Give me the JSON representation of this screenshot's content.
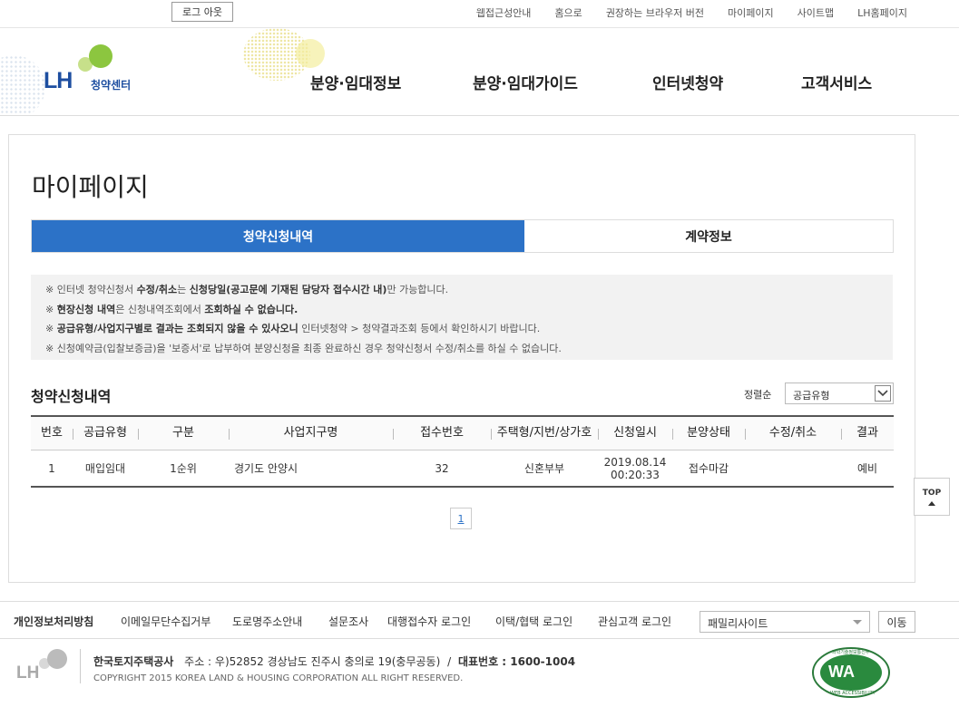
{
  "topbar": {
    "logout": "로그 아웃",
    "links": [
      "웹접근성안내",
      "홈으로",
      "권장하는 브라우저 버전",
      "마이페이지",
      "사이트맵",
      "LH홈페이지"
    ]
  },
  "header": {
    "logo_text": "LH",
    "logo_sub": "청약센터",
    "nav": [
      "분양·임대정보",
      "분양·임대가이드",
      "인터넷청약",
      "고객서비스"
    ]
  },
  "main": {
    "title": "마이페이지",
    "tabs": [
      {
        "label": "청약신청내역",
        "active": true
      },
      {
        "label": "계약정보",
        "active": false
      }
    ],
    "notice": [
      {
        "pre": "※ 인터넷 청약신청서 ",
        "bold": "수정/취소",
        "mid": "는 ",
        "bold2": "신청당일(공고문에 기재된 담당자 접수시간 내)",
        "post": "만 가능합니다."
      },
      {
        "pre": "※ ",
        "bold": "현장신청 내역",
        "mid": "은 신청내역조회에서 ",
        "bold2": "조회하실 수 없습니다.",
        "post": ""
      },
      {
        "pre": "※ ",
        "bold": "공급유형/사업지구별로 결과는 조회되지 않을 수 있사오니",
        "mid": " 인터넷청약 > 청약결과조회 등에서 확인하시기 바랍니다.",
        "bold2": "",
        "post": ""
      },
      {
        "pre": "※ 신청예약금(입찰보증금)을 '보증서'로 납부하여 분양신청을 최종 완료하신 경우 청약신청서 수정/취소를 하실 수 없습니다.",
        "bold": "",
        "mid": "",
        "bold2": "",
        "post": ""
      }
    ],
    "section_title": "청약신청내역",
    "sort_label": "정렬순",
    "sort_value": "공급유형",
    "table": {
      "headers": [
        "번호",
        "공급유형",
        "구분",
        "사업지구명",
        "접수번호",
        "주택형/지번/상가호",
        "신청일시",
        "분양상태",
        "수정/취소",
        "결과"
      ],
      "rows": [
        [
          "1",
          "매입임대",
          "1순위",
          "경기도 안양시",
          "32",
          "신혼부부",
          "2019.08.14\n00:20:33",
          "접수마감",
          "",
          "예비"
        ]
      ]
    },
    "pagination": [
      "1"
    ],
    "top_button": "TOP"
  },
  "footer": {
    "links": [
      "개인정보처리방침",
      "이메일무단수집거부",
      "도로명주소안내",
      "설문조사",
      "대행접수자 로그인",
      "이택/협택 로그인",
      "관심고객 로그인"
    ],
    "family_site": "패밀리사이트",
    "go_button": "이동",
    "logo_text": "LH",
    "company": "한국토지주택공사",
    "address": "주소 : 우)52852 경상남도 진주시 충의로 19(충무공동)",
    "separator": "/",
    "phone": "대표번호 : 1600-1004",
    "copyright": "COPYRIGHT 2015 KOREA LAND & HOUSING CORPORATION ALL RIGHT RESERVED.",
    "badge_text": "WA",
    "badge_top": "과학기술정보통신부",
    "badge_bottom": "WEB ACCESSIBILITY"
  },
  "colors": {
    "primary": "#2c72c7",
    "brand_blue": "#1d4ea0",
    "brand_green": "#8cc63f"
  }
}
